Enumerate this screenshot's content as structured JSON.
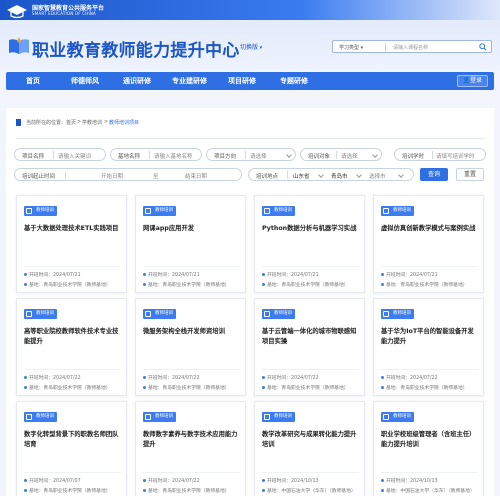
{
  "header": {
    "top_title": "国家智慧教育公共服务平台",
    "top_subtitle": "SMART EDUCATION OF CHINA",
    "brand_title": "职业教育教师能力提升中心",
    "switch_label": "切换版",
    "search": {
      "type_label": "学习类型",
      "placeholder": "请输入课程名称"
    },
    "logo_icon": "open-book-icon"
  },
  "nav": {
    "items": [
      "首页",
      "师德师风",
      "通识研修",
      "专业建研修",
      "项目研修",
      "专题研修"
    ],
    "login_label": "登录"
  },
  "breadcrumb": {
    "prefix": "当前所在的位置：",
    "items": [
      "首页",
      "学教培训",
      "教师培训项目"
    ]
  },
  "filters": {
    "project_name": {
      "label": "项目名称",
      "placeholder": "请输入关键词"
    },
    "base_name": {
      "label": "基地名称",
      "placeholder": "请输入基地名称"
    },
    "project_direction": {
      "label": "项目方向",
      "value": "请选择"
    },
    "target": {
      "label": "培训对象",
      "value": "请选择"
    },
    "hours": {
      "label": "培训学时",
      "placeholder": "请填写培训学时"
    },
    "period": {
      "label": "培训起止时间",
      "start": "开始日期",
      "to": "至",
      "end": "结束日期"
    },
    "location": {
      "label": "培训地点",
      "province": "山东省",
      "city": "青岛市",
      "district": "选择市"
    },
    "query_label": "查询",
    "reset_label": "重置"
  },
  "cards": [
    {
      "tag": "教师培训",
      "title": "基于大数据处理技术ETL实践项目",
      "date_label": "开班时间：",
      "date": "2024/07/21",
      "base_label": "基地：",
      "base": "青岛职业技术学院（教师基地）"
    },
    {
      "tag": "教师培训",
      "title": "网课app应用开发",
      "date_label": "开班时间：",
      "date": "2024/07/21",
      "base_label": "基地：",
      "base": "青岛职业技术学院（教师基地）"
    },
    {
      "tag": "教师培训",
      "title": "Python数据分析与机器学习实战",
      "date_label": "开班时间：",
      "date": "2024/07/21",
      "base_label": "基地：",
      "base": "青岛职业技术学院（教师基地）"
    },
    {
      "tag": "教师培训",
      "title": "虚拟仿真创新教学模式与案例实战",
      "date_label": "开班时间：",
      "date": "2024/07/21",
      "base_label": "基地：",
      "base": "青岛职业技术学院（教师基地）"
    },
    {
      "tag": "教师培训",
      "title": "高等职业院校教师软件技术专业技能提升",
      "date_label": "开班时间：",
      "date": "2024/07/22",
      "base_label": "基地：",
      "base": "青岛职业技术学院（教师基地）"
    },
    {
      "tag": "教师培训",
      "title": "微服务架构全栈开发师资培训",
      "date_label": "开班时间：",
      "date": "2024/07/22",
      "base_label": "基地：",
      "base": "青岛职业技术学院（教师基地）"
    },
    {
      "tag": "教师培训",
      "title": "基于云管端一体化的城市物联感知项目实操",
      "date_label": "开班时间：",
      "date": "2024/07/22",
      "base_label": "基地：",
      "base": "青岛职业技术学院（教师基地）"
    },
    {
      "tag": "教师培训",
      "title": "基于华为IoT平台的智能设备开发能力提升",
      "date_label": "开班时间：",
      "date": "2024/07/22",
      "base_label": "基地：",
      "base": "青岛职业技术学院（教师基地）"
    },
    {
      "tag": "教师培训",
      "title": "数字化转型背景下的职教名师团队培育",
      "date_label": "开班时间：",
      "date": "2024/07/07",
      "base_label": "基地：",
      "base": "青岛职业技术学院（教师基地）"
    },
    {
      "tag": "教师培训",
      "title": "教师数字素养与数字技术应用能力提升",
      "date_label": "开班时间：",
      "date": "2024/07/22",
      "base_label": "基地：",
      "base": "青岛职业技术学院（教师基地）"
    },
    {
      "tag": "教师培训",
      "title": "教学改革研究与成果转化能力提升培训",
      "date_label": "开班时间：",
      "date": "2024/10/13",
      "base_label": "基地：",
      "base": "中国石油大学（华东）（教师基地）"
    },
    {
      "tag": "教师培训",
      "title": "职业学校班级管理者（含班主任）能力提升培训",
      "date_label": "开班时间：",
      "date": "2024/10/13",
      "base_label": "基地：",
      "base": "中国石油大学（华东）（教师基地）"
    }
  ],
  "colors": {
    "primary": "#2f6fe4",
    "brand": "#1b55c8",
    "background": "#f2f5fb"
  }
}
